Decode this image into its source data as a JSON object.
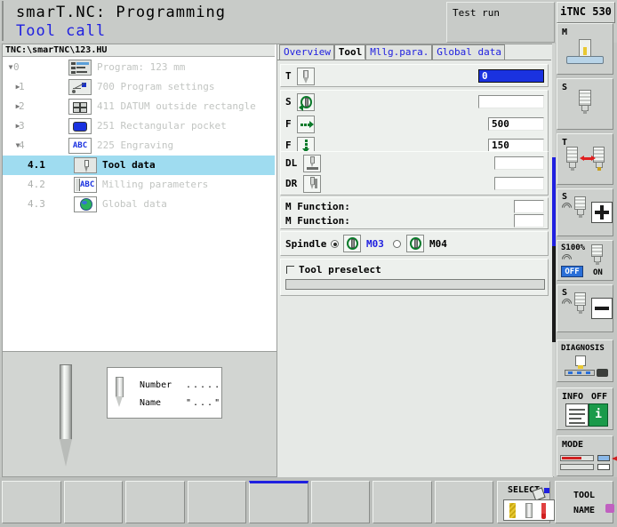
{
  "header": {
    "title": "smarT.NC: Programming",
    "subtitle": "Tool call",
    "mode_status": "Test run",
    "brand": "iTNC 530"
  },
  "tree": {
    "path": "TNC:\\smarTNC\\123.HU",
    "items": [
      {
        "num": "0",
        "label": "Program: 123 mm",
        "icon": "program-icon",
        "arrow": "▼",
        "indent": 0,
        "selected": false
      },
      {
        "num": "1",
        "label": "700 Program settings",
        "icon": "settings-icon",
        "arrow": "▶",
        "indent": 1,
        "selected": false
      },
      {
        "num": "2",
        "label": "411 DATUM outside rectangle",
        "icon": "grid-icon",
        "arrow": "▶",
        "indent": 1,
        "selected": false
      },
      {
        "num": "3",
        "label": "251 Rectangular pocket",
        "icon": "rect-pocket-icon",
        "arrow": "▶",
        "indent": 1,
        "selected": false
      },
      {
        "num": "4",
        "label": "225 Engraving",
        "icon": "abc-icon",
        "arrow": "▼",
        "indent": 1,
        "selected": false
      },
      {
        "num": "4.1",
        "label": "Tool data",
        "icon": "tool-icon",
        "arrow": "",
        "indent": 2,
        "selected": true
      },
      {
        "num": "4.2",
        "label": "Milling parameters",
        "icon": "abc-bar-icon",
        "arrow": "",
        "indent": 2,
        "selected": false
      },
      {
        "num": "4.3",
        "label": "Global data",
        "icon": "globe-icon",
        "arrow": "",
        "indent": 2,
        "selected": false
      }
    ]
  },
  "preview": {
    "number_label": "Number",
    "number_value": ".....",
    "name_label": "Name",
    "name_value": "\"...\""
  },
  "form": {
    "tabs": [
      {
        "label": "Overview",
        "active": false
      },
      {
        "label": "Tool",
        "active": true
      },
      {
        "label": "Mllg.para.",
        "active": false
      },
      {
        "label": "Global data",
        "active": false
      }
    ],
    "fields": [
      {
        "key": "T",
        "icon": "tool-icon",
        "value": "0",
        "focused": true
      },
      {
        "key": "S",
        "icon": "spindle-icon",
        "value": "",
        "focused": false
      },
      {
        "key": "F",
        "icon": "feed-icon",
        "value": "500",
        "focused": false
      },
      {
        "key": "F",
        "icon": "plunge-icon",
        "value": "150",
        "focused": false
      },
      {
        "key": "DL",
        "icon": "length-delta-icon",
        "value": "",
        "focused": false
      },
      {
        "key": "DR",
        "icon": "radius-delta-icon",
        "value": "",
        "focused": false
      }
    ],
    "m_functions": [
      {
        "label": "M Function:",
        "value": ""
      },
      {
        "label": "M Function:",
        "value": ""
      }
    ],
    "spindle": {
      "label": "Spindle",
      "options": [
        {
          "label": "M03",
          "selected": true
        },
        {
          "label": "M04",
          "selected": false
        }
      ]
    },
    "tool_preselect": {
      "label": "Tool preselect",
      "checked": false,
      "value": ""
    }
  },
  "vertical_keys": [
    {
      "name": "machine-key",
      "label": "M",
      "label2": ""
    },
    {
      "name": "spindle-key",
      "label": "S",
      "label2": ""
    },
    {
      "name": "tool-change-key",
      "label": "T",
      "label2": ""
    },
    {
      "name": "speed-up-key",
      "label": "S",
      "label2": ""
    },
    {
      "name": "spindle-override-key",
      "label": "S100%",
      "label2": "OFF",
      "label3": "ON"
    },
    {
      "name": "speed-down-key",
      "label": "S",
      "label2": ""
    },
    {
      "name": "diagnosis-key",
      "label": "DIAGNOSIS",
      "label2": ""
    },
    {
      "name": "info-key",
      "label": "INFO",
      "label2": "OFF"
    },
    {
      "name": "mode-key",
      "label": "MODE",
      "label2": ""
    }
  ],
  "bottom_keys": [
    {
      "label": "",
      "highlight": false
    },
    {
      "label": "",
      "highlight": false
    },
    {
      "label": "",
      "highlight": false
    },
    {
      "label": "",
      "highlight": false
    },
    {
      "label": "",
      "highlight": true
    },
    {
      "label": "",
      "highlight": false
    },
    {
      "label": "",
      "highlight": false
    },
    {
      "label": "",
      "highlight": false
    }
  ],
  "select_key": {
    "label": "SELECT"
  },
  "tool_name_key": {
    "line1": "TOOL",
    "line2": "NAME"
  },
  "colors": {
    "accent_blue": "#2020e0",
    "selection_cyan": "#9fdcf0",
    "panel_gray": "#c3c6c3",
    "field_white": "#ffffff",
    "icon_green": "#0a7a2a"
  }
}
